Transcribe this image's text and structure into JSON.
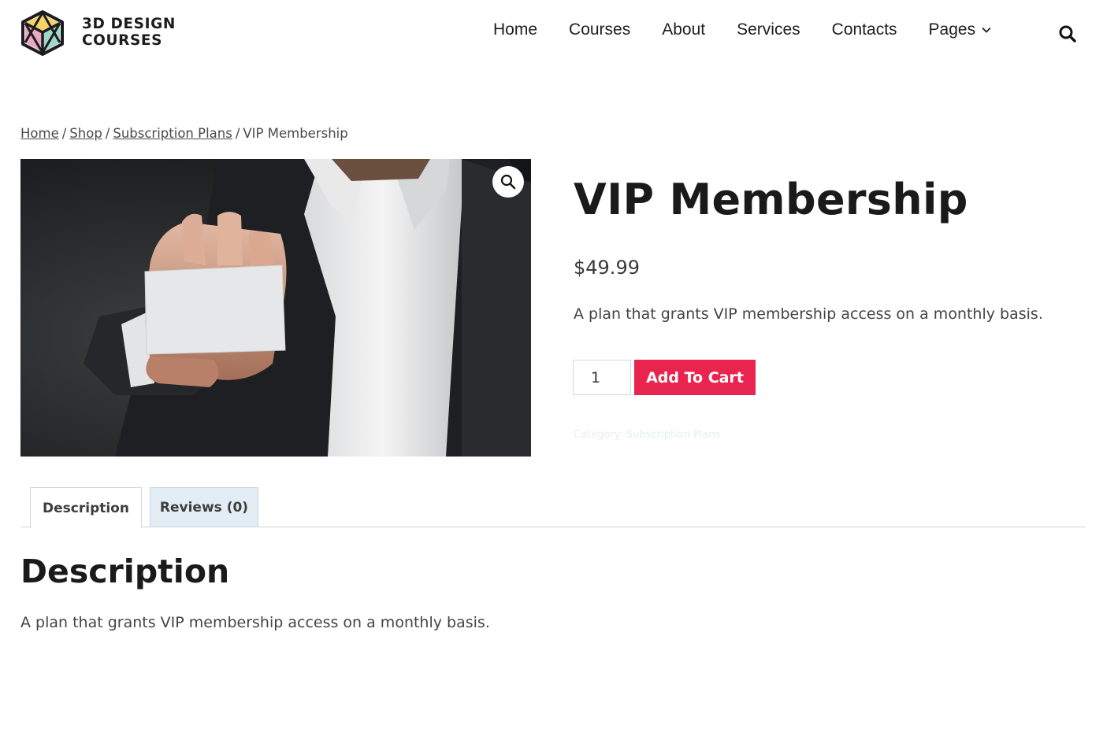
{
  "header": {
    "brand_line1": "3D DESIGN",
    "brand_line2": "COURSES",
    "nav": [
      {
        "label": "Home"
      },
      {
        "label": "Courses"
      },
      {
        "label": "About"
      },
      {
        "label": "Services"
      },
      {
        "label": "Contacts"
      },
      {
        "label": "Pages",
        "has_dropdown": true
      }
    ],
    "search_icon": "search-icon"
  },
  "breadcrumb": {
    "items": [
      "Home",
      "Shop",
      "Subscription Plans"
    ],
    "separator": "/",
    "current": "VIP Membership"
  },
  "product": {
    "image_alt": "Man in suit holding a blank business card",
    "zoom_icon": "magnifier-icon",
    "title": "VIP Membership",
    "price": "$49.99",
    "short_description": "A plan that grants VIP membership access on a monthly basis.",
    "quantity": "1",
    "add_to_cart_label": "Add To Cart",
    "category_label": "Category:",
    "category_value": "Subscription Plans"
  },
  "tabs": [
    {
      "label": "Description",
      "active": true
    },
    {
      "label": "Reviews (0)",
      "active": false
    }
  ],
  "description": {
    "heading": "Description",
    "body": "A plan that grants VIP membership access on a monthly basis."
  },
  "colors": {
    "accent": "#e9254f",
    "tab_inactive_bg": "#e2edf5",
    "text": "#1a1a1a"
  }
}
